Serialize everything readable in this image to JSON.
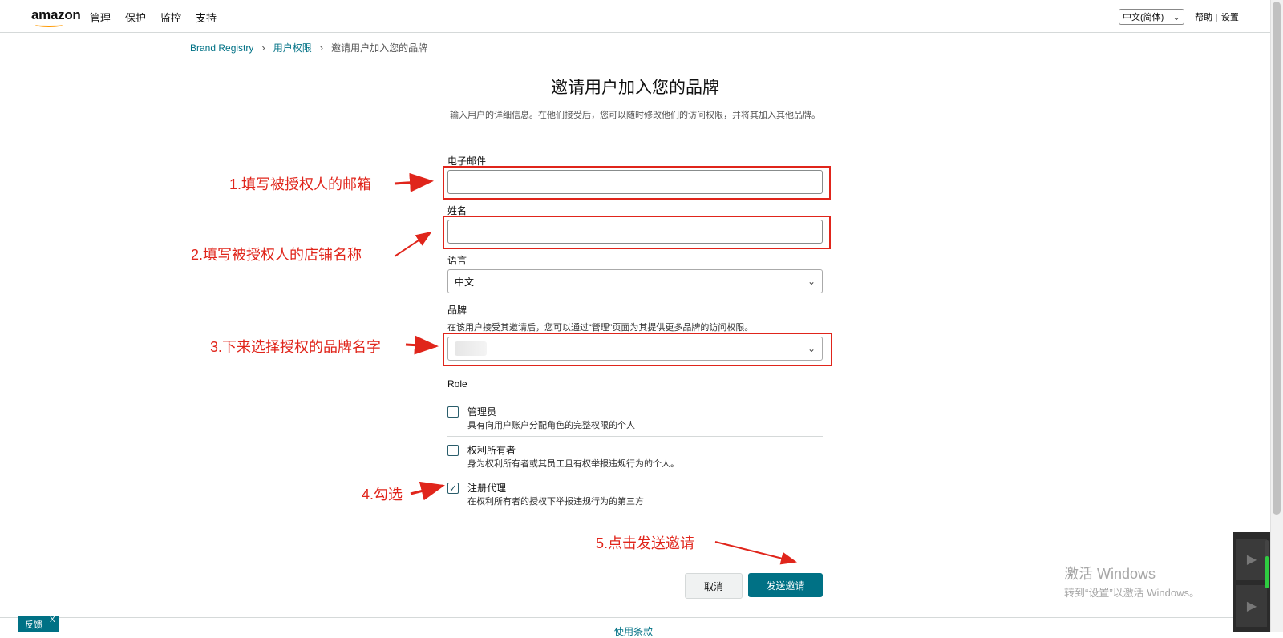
{
  "header": {
    "logo": "amazon",
    "nav": [
      "管理",
      "保护",
      "监控",
      "支持"
    ],
    "language_select": "中文(简体)",
    "help": "帮助",
    "settings": "设置"
  },
  "breadcrumb": {
    "root": "Brand Registry",
    "parent": "用户权限",
    "current": "邀请用户加入您的品牌"
  },
  "form": {
    "title": "邀请用户加入您的品牌",
    "subtitle": "输入用户的详细信息。在他们接受后，您可以随时修改他们的访问权限，并将其加入其他品牌。",
    "email_label": "电子邮件",
    "email_value": "",
    "name_label": "姓名",
    "name_value": "",
    "language_label": "语言",
    "language_value": "中文",
    "brand_label": "品牌",
    "brand_hint": "在该用户接受其邀请后，您可以通过“管理”页面为其提供更多品牌的访问权限。",
    "role_label": "Role",
    "roles": [
      {
        "title": "管理员",
        "desc": "具有向用户账户分配角色的完整权限的个人",
        "checked": false
      },
      {
        "title": "权利所有者",
        "desc": "身为权利所有者或其员工且有权举报违规行为的个人。",
        "checked": false
      },
      {
        "title": "注册代理",
        "desc": "在权利所有者的授权下举报违规行为的第三方",
        "checked": true
      }
    ],
    "cancel_label": "取消",
    "send_label": "发送邀请"
  },
  "footer": {
    "terms": "使用条款",
    "feedback": "反馈",
    "feedback_close": "X"
  },
  "annotations": {
    "step1": "1.填写被授权人的邮箱",
    "step2": "2.填写被授权人的店铺名称",
    "step3": "3.下来选择授权的品牌名字",
    "step4": "4.勾选",
    "step5": "5.点击发送邀请",
    "color": "#e0251b"
  },
  "watermark": {
    "line1": "激活 Windows",
    "line2": "转到“设置”以激活 Windows。"
  },
  "colors": {
    "teal": "#007185",
    "orange": "#ff9900"
  }
}
